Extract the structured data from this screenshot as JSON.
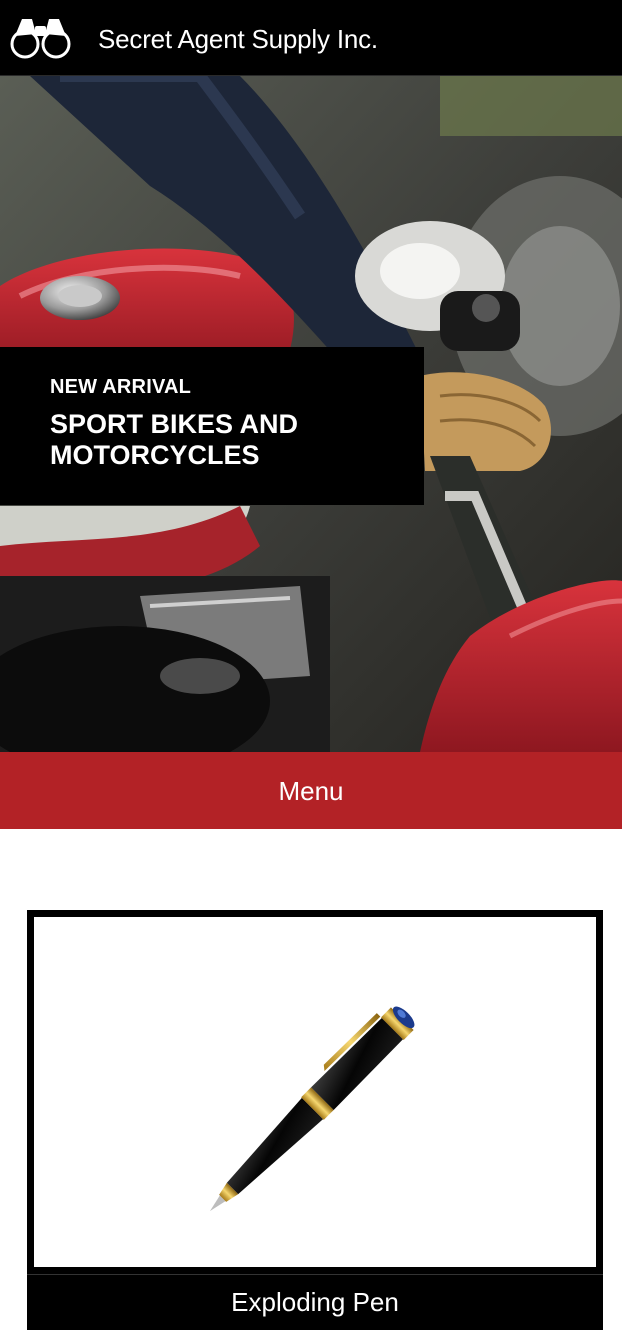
{
  "header": {
    "brand_name": "Secret Agent Supply Inc.",
    "logo_icon": "binoculars-icon"
  },
  "hero": {
    "eyebrow": "NEW ARRIVAL",
    "title": "SPORT BIKES AND MOTORCYCLES",
    "image_subject": "motorcycle-photo"
  },
  "menu": {
    "label": "Menu"
  },
  "products": [
    {
      "name": "Exploding Pen",
      "image_subject": "pen-photo"
    }
  ],
  "colors": {
    "header_bg": "#000000",
    "menu_bg": "#b32226",
    "text_light": "#ffffff"
  }
}
